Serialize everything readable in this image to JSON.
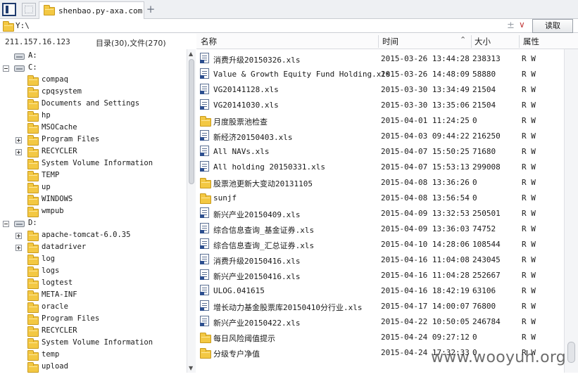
{
  "tab": {
    "label": "shenbao.py-axa.com"
  },
  "tab_add": "+",
  "address": {
    "path": "Y:\\",
    "clear_symbol": "±",
    "dropdown_symbol": "∨",
    "read_button": "读取"
  },
  "left_panel": {
    "ip": "211.157.16.123",
    "counts": "目录(30),文件(270)"
  },
  "tree": [
    {
      "label": "A:",
      "kind": "drive",
      "level": 0,
      "toggle": "none"
    },
    {
      "label": "C:",
      "kind": "drive",
      "level": 0,
      "toggle": "minus"
    },
    {
      "label": "compaq",
      "kind": "folder",
      "level": 1,
      "toggle": "none"
    },
    {
      "label": "cpqsystem",
      "kind": "folder",
      "level": 1,
      "toggle": "none"
    },
    {
      "label": "Documents and Settings",
      "kind": "folder",
      "level": 1,
      "toggle": "none"
    },
    {
      "label": "hp",
      "kind": "folder",
      "level": 1,
      "toggle": "none"
    },
    {
      "label": "MSOCache",
      "kind": "folder",
      "level": 1,
      "toggle": "none"
    },
    {
      "label": "Program Files",
      "kind": "folder",
      "level": 1,
      "toggle": "plus"
    },
    {
      "label": "RECYCLER",
      "kind": "folder",
      "level": 1,
      "toggle": "plus"
    },
    {
      "label": "System Volume Information",
      "kind": "folder",
      "level": 1,
      "toggle": "none"
    },
    {
      "label": "TEMP",
      "kind": "folder",
      "level": 1,
      "toggle": "none"
    },
    {
      "label": "up",
      "kind": "folder",
      "level": 1,
      "toggle": "none"
    },
    {
      "label": "WINDOWS",
      "kind": "folder",
      "level": 1,
      "toggle": "none"
    },
    {
      "label": "wmpub",
      "kind": "folder",
      "level": 1,
      "toggle": "none"
    },
    {
      "label": "D:",
      "kind": "drive",
      "level": 0,
      "toggle": "minus"
    },
    {
      "label": "apache-tomcat-6.0.35",
      "kind": "folder",
      "level": 1,
      "toggle": "plus"
    },
    {
      "label": "datadriver",
      "kind": "folder",
      "level": 1,
      "toggle": "plus"
    },
    {
      "label": "log",
      "kind": "folder",
      "level": 1,
      "toggle": "none"
    },
    {
      "label": "logs",
      "kind": "folder",
      "level": 1,
      "toggle": "none"
    },
    {
      "label": "logtest",
      "kind": "folder",
      "level": 1,
      "toggle": "none"
    },
    {
      "label": "META-INF",
      "kind": "folder",
      "level": 1,
      "toggle": "none"
    },
    {
      "label": "oracle",
      "kind": "folder",
      "level": 1,
      "toggle": "none"
    },
    {
      "label": "Program Files",
      "kind": "folder",
      "level": 1,
      "toggle": "none"
    },
    {
      "label": "RECYCLER",
      "kind": "folder",
      "level": 1,
      "toggle": "none"
    },
    {
      "label": "System Volume Information",
      "kind": "folder",
      "level": 1,
      "toggle": "none"
    },
    {
      "label": "temp",
      "kind": "folder",
      "level": 1,
      "toggle": "none"
    },
    {
      "label": "upload",
      "kind": "folder",
      "level": 1,
      "toggle": "none"
    }
  ],
  "columns": {
    "name": "名称",
    "time": "时间",
    "size": "大小",
    "attr": "属性"
  },
  "files": [
    {
      "icon": "xls",
      "name": "消费升级20150326.xls",
      "time": "2015-03-26 13:44:28",
      "size": "238313",
      "attr": "R W"
    },
    {
      "icon": "xls",
      "name": "Value & Growth Equity Fund Holding.xls",
      "time": "2015-03-26 14:48:09",
      "size": "58880",
      "attr": "R W"
    },
    {
      "icon": "xls",
      "name": "VG20141128.xls",
      "time": "2015-03-30 13:34:49",
      "size": "21504",
      "attr": "R W"
    },
    {
      "icon": "xls",
      "name": "VG20141030.xls",
      "time": "2015-03-30 13:35:06",
      "size": "21504",
      "attr": "R W"
    },
    {
      "icon": "folder",
      "name": "月度股票池检查",
      "time": "2015-04-01 11:24:25",
      "size": "0",
      "attr": "R W"
    },
    {
      "icon": "xls",
      "name": "新经济20150403.xls",
      "time": "2015-04-03 09:44:22",
      "size": "216250",
      "attr": "R W"
    },
    {
      "icon": "xls",
      "name": "All NAVs.xls",
      "time": "2015-04-07 15:50:25",
      "size": "71680",
      "attr": "R W"
    },
    {
      "icon": "xls",
      "name": "All holding 20150331.xls",
      "time": "2015-04-07 15:53:13",
      "size": "299008",
      "attr": "R W"
    },
    {
      "icon": "folder",
      "name": "股票池更新大变动20131105",
      "time": "2015-04-08 13:36:26",
      "size": "0",
      "attr": "R W"
    },
    {
      "icon": "folder",
      "name": "sunjf",
      "time": "2015-04-08 13:56:54",
      "size": "0",
      "attr": "R W"
    },
    {
      "icon": "xls",
      "name": "新兴产业20150409.xls",
      "time": "2015-04-09 13:32:53",
      "size": "250501",
      "attr": "R W"
    },
    {
      "icon": "xls",
      "name": "综合信息查询_基金证券.xls",
      "time": "2015-04-09 13:36:03",
      "size": "74752",
      "attr": "R W"
    },
    {
      "icon": "xls",
      "name": "综合信息查询_汇总证券.xls",
      "time": "2015-04-10 14:28:06",
      "size": "108544",
      "attr": "R W"
    },
    {
      "icon": "xls",
      "name": "消费升级20150416.xls",
      "time": "2015-04-16 11:04:08",
      "size": "243045",
      "attr": "R W"
    },
    {
      "icon": "xls",
      "name": "新兴产业20150416.xls",
      "time": "2015-04-16 11:04:28",
      "size": "252667",
      "attr": "R W"
    },
    {
      "icon": "xls",
      "name": "ULOG.041615",
      "time": "2015-04-16 18:42:19",
      "size": "63106",
      "attr": "R W"
    },
    {
      "icon": "xls",
      "name": "增长动力基金股票库20150410分行业.xls",
      "time": "2015-04-17 14:00:07",
      "size": "76800",
      "attr": "R W"
    },
    {
      "icon": "xls",
      "name": "新兴产业20150422.xls",
      "time": "2015-04-22 10:50:05",
      "size": "246784",
      "attr": "R W"
    },
    {
      "icon": "folder",
      "name": "每日风险阈值提示",
      "time": "2015-04-24 09:27:12",
      "size": "0",
      "attr": "R W"
    },
    {
      "icon": "folder",
      "name": "分级专户净值",
      "time": "2015-04-24 17:32:33",
      "size": "0",
      "attr": "R W"
    }
  ],
  "watermark": "www.wooyuh.org"
}
